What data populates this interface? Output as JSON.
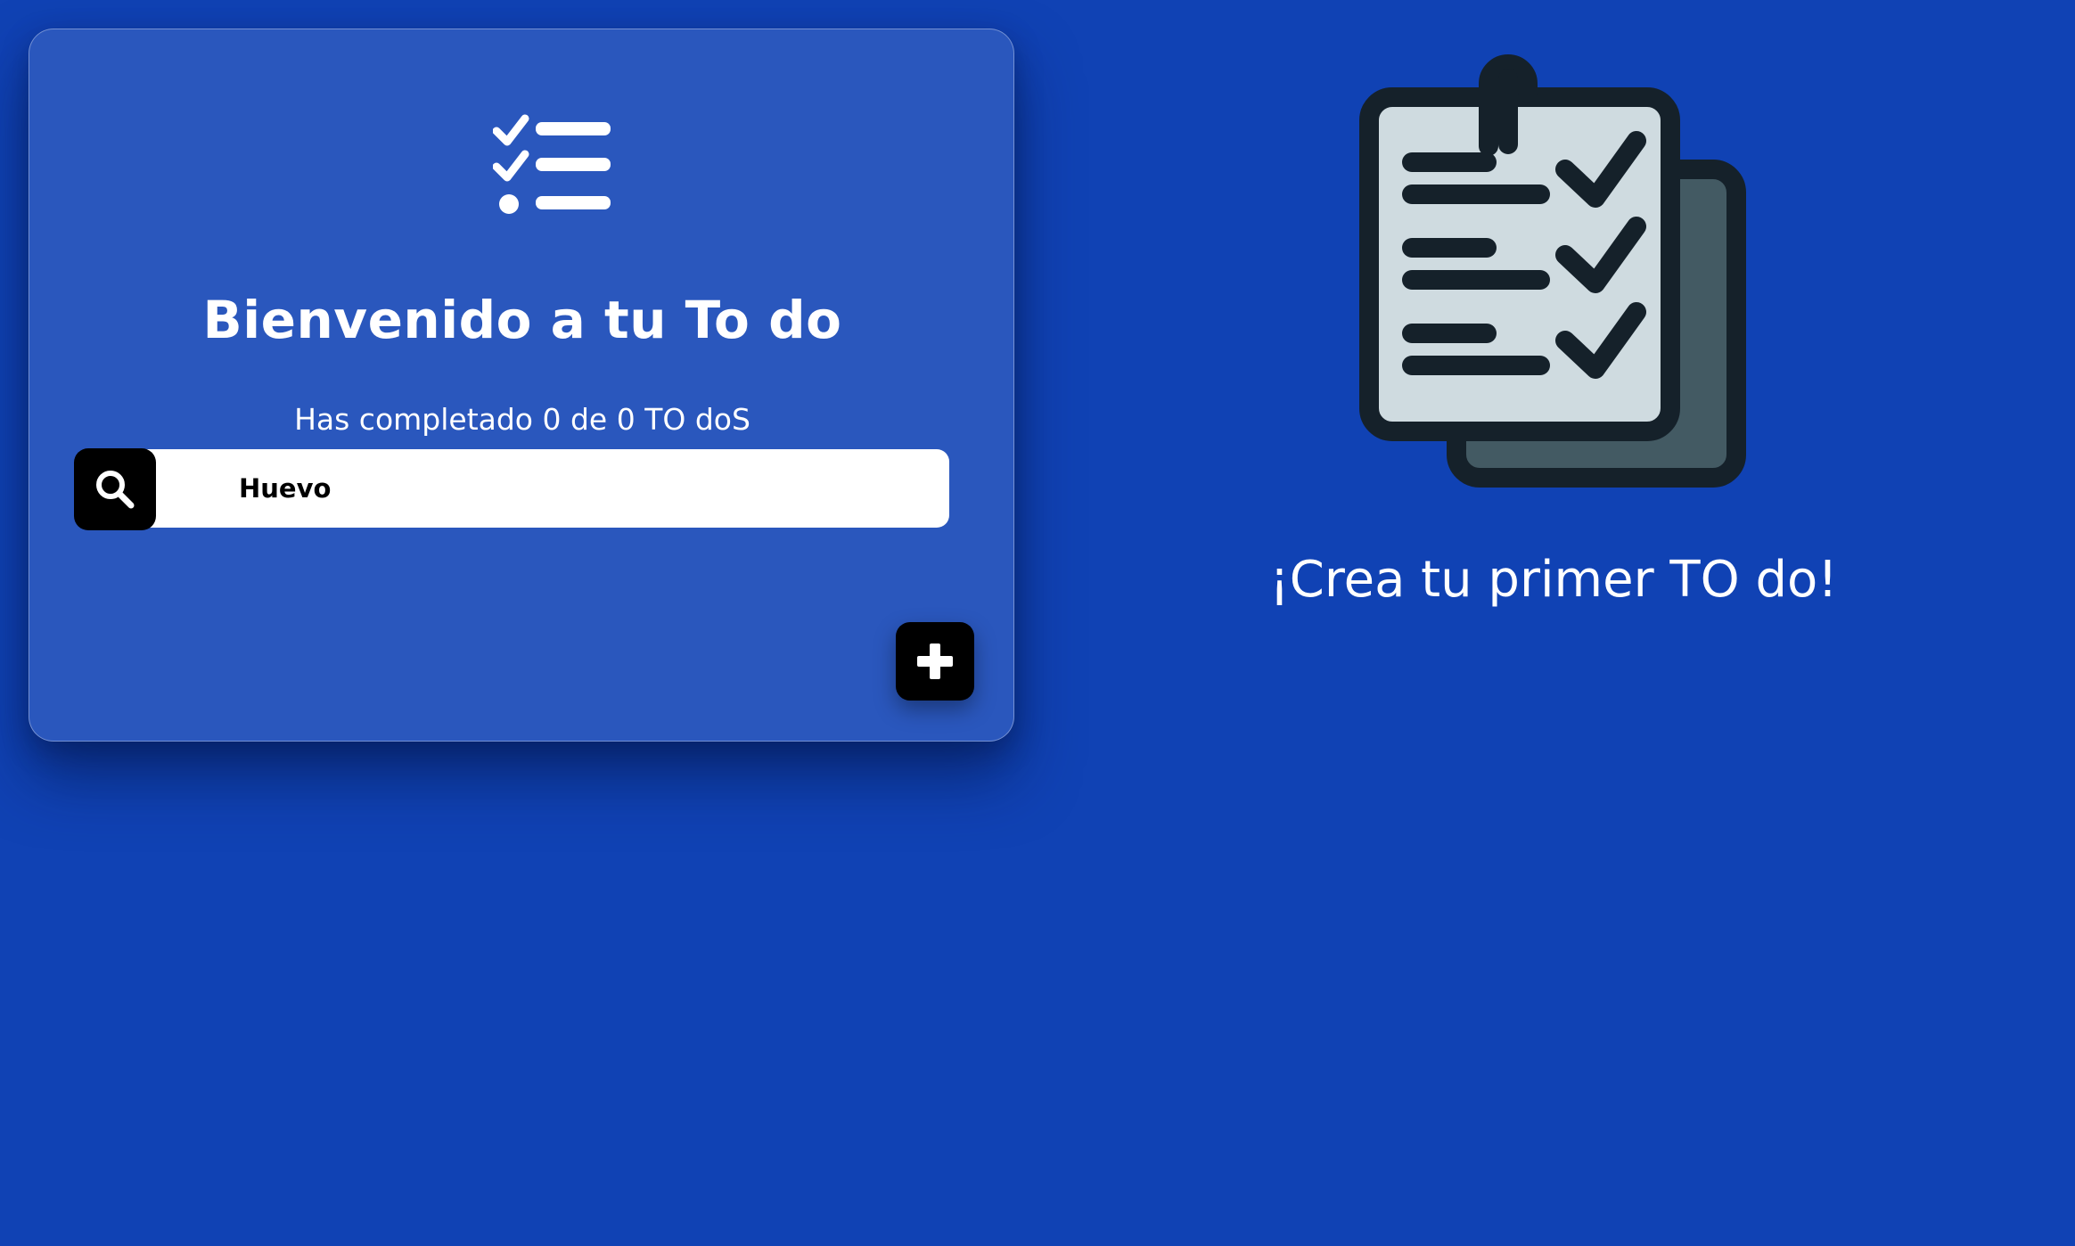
{
  "card": {
    "title": "Bienvenido a tu To do",
    "progress_text": "Has completado 0 de 0 TO doS",
    "completed_count": 0,
    "total_count": 0
  },
  "search": {
    "value": "Huevo",
    "placeholder": ""
  },
  "empty_state": {
    "message": "¡Crea tu primer TO do!"
  },
  "icons": {
    "logo": "checklist-icon",
    "search": "search-icon",
    "add": "plus-icon",
    "illustration": "clipboard-checklist-icon"
  },
  "colors": {
    "background": "#1042b4",
    "card": "#2a57bd",
    "button": "#000000",
    "text": "#ffffff"
  }
}
